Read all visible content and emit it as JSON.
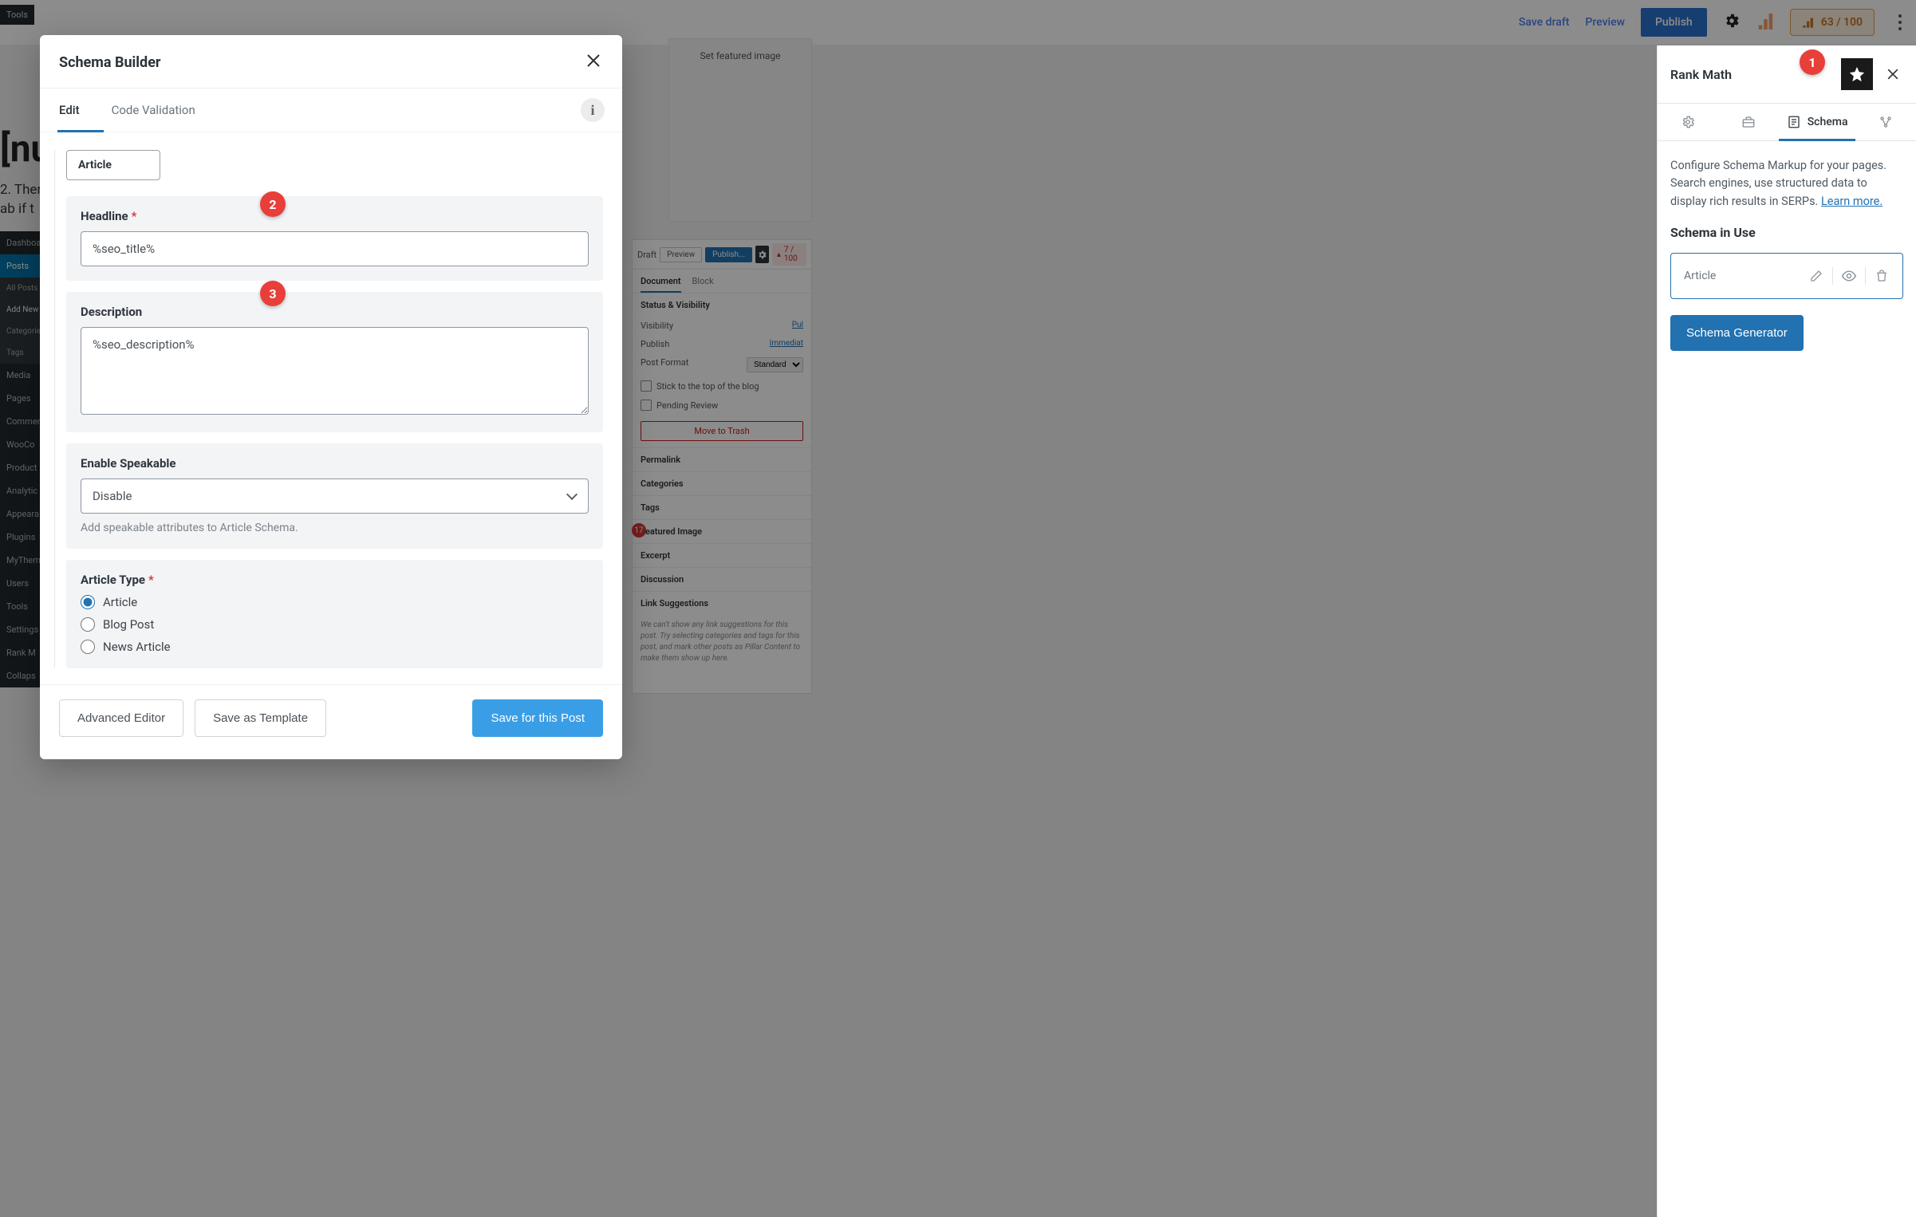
{
  "topbar": {
    "save_draft": "Save draft",
    "preview": "Preview",
    "publish": "Publish",
    "score": "63 / 100"
  },
  "rank_math_panel": {
    "title": "Rank Math",
    "tabs": {
      "schema": "Schema"
    },
    "intro": "Configure Schema Markup for your pages. Search engines, use structured data to display rich results in SERPs. ",
    "learn_more": "Learn more.",
    "in_use_heading": "Schema in Use",
    "in_use_item": "Article",
    "generator_btn": "Schema Generator"
  },
  "modal": {
    "title": "Schema Builder",
    "tabs": {
      "edit": "Edit",
      "code": "Code Validation"
    },
    "article_chip": "Article",
    "headline_label": "Headline",
    "headline_value": "%seo_title%",
    "description_label": "Description",
    "description_value": "%seo_description%",
    "speakable_label": "Enable Speakable",
    "speakable_value": "Disable",
    "speakable_help": "Add speakable attributes to Article Schema.",
    "article_type_label": "Article Type",
    "article_type_opts": [
      "Article",
      "Blog Post",
      "News Article"
    ],
    "footer": {
      "advanced": "Advanced Editor",
      "save_template": "Save as Template",
      "save_post": "Save for this Post"
    }
  },
  "mid_panel": {
    "draft": "Draft",
    "preview": "Preview",
    "publish": "Publish...",
    "score": "7 / 100",
    "tab_document": "Document",
    "tab_block": "Block",
    "status_vis": "Status & Visibility",
    "visibility_label": "Visibility",
    "visibility_val": "Pul",
    "publish_label": "Publish",
    "publish_val": "Immediat",
    "format_label": "Post Format",
    "format_val": "Standard",
    "stick": "Stick to the top of the blog",
    "pending": "Pending Review",
    "trash": "Move to Trash",
    "permalink": "Permalink",
    "categories": "Categories",
    "tags": "Tags",
    "featured": "Featured Image",
    "excerpt": "Excerpt",
    "discussion": "Discussion",
    "link_sugg": "Link Suggestions",
    "hint": "We can't show any link suggestions for this post. Try selecting categories and tags for this post, and mark other posts as Pillar Content to make them show up here."
  },
  "wp_sidenav": {
    "dashboard": "Dashboard",
    "posts": "Posts",
    "all_posts": "All Posts",
    "add_new": "Add New",
    "categories": "Categories",
    "tags": "Tags",
    "media": "Media",
    "pages": "Pages",
    "comments": "Commen",
    "woo": "WooCo",
    "products": "Product",
    "analytics": "Analytic",
    "appearance": "Appeara",
    "plugins": "Plugins",
    "mytheme": "MyThem",
    "users": "Users",
    "tools": "Tools",
    "settings": "Settings",
    "rankmath": "Rank M",
    "collapse": "Collaps"
  },
  "bg": {
    "tools": "Tools",
    "title_frag": "[nu",
    "line1": "2. Ther",
    "line2": "ab if t",
    "featured": "Set featured image",
    "badge17": "17"
  },
  "callouts": {
    "c1": "1",
    "c2": "2",
    "c3": "3"
  }
}
